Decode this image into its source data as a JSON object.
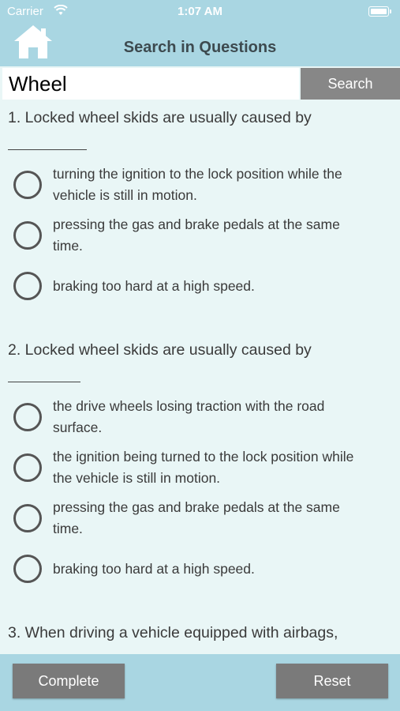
{
  "status_bar": {
    "carrier": "Carrier",
    "time": "1:07 AM"
  },
  "header": {
    "title": "Search in Questions"
  },
  "search": {
    "value": "Wheel",
    "button_label": "Search"
  },
  "questions": [
    {
      "text": "1. Locked wheel skids are usually caused by",
      "options": [
        "turning the ignition to the lock position while the vehicle is still in motion.",
        "pressing the gas and brake pedals at the same time.",
        "braking too hard at a high speed."
      ]
    },
    {
      "text": "2. Locked wheel skids are usually caused by",
      "options": [
        "the drive wheels losing traction with the road surface.",
        "the ignition being turned to the lock position while the vehicle is still in motion.",
        "pressing the gas and brake pedals at the same time.",
        "braking too hard at a high speed."
      ]
    },
    {
      "text": "3. When driving a vehicle equipped with airbags,"
    }
  ],
  "footer": {
    "complete_label": "Complete",
    "reset_label": "Reset"
  },
  "colors": {
    "header_bg": "#a9d6e2",
    "page_bg": "#e9f6f6",
    "button_gray": "#7a7a7a"
  }
}
